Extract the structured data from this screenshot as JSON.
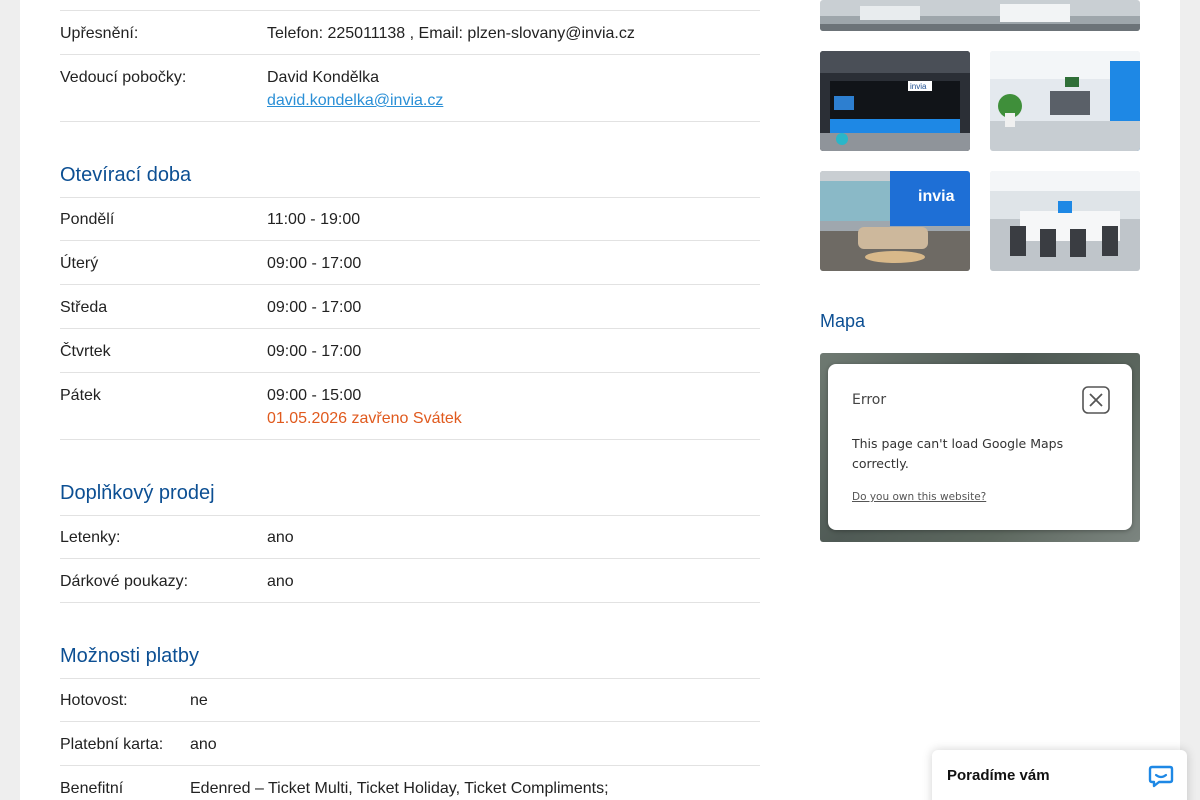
{
  "contact": {
    "refine_label": "Upřesnění:",
    "refine_value": "Telefon: 225011138 , Email: plzen-slovany@invia.cz",
    "manager_label": "Vedoucí pobočky:",
    "manager_name": "David Kondělka",
    "manager_email": "david.kondelka@invia.cz"
  },
  "opening_hours": {
    "title": "Otevírací doba",
    "days": [
      {
        "day": "Pondělí",
        "hours": "11:00 - 19:00"
      },
      {
        "day": "Úterý",
        "hours": "09:00 - 17:00"
      },
      {
        "day": "Středa",
        "hours": "09:00 - 17:00"
      },
      {
        "day": "Čtvrtek",
        "hours": "09:00 - 17:00"
      },
      {
        "day": "Pátek",
        "hours": "09:00 - 15:00",
        "note": "01.05.2026 zavřeno Svátek"
      }
    ]
  },
  "extra_sales": {
    "title": "Doplňkový prodej",
    "items": [
      {
        "label": "Letenky:",
        "value": "ano"
      },
      {
        "label": "Dárkové poukazy:",
        "value": "ano"
      }
    ]
  },
  "payment": {
    "title": "Možnosti platby",
    "items": [
      {
        "label": "Hotovost:",
        "value": "ne"
      },
      {
        "label": "Platební karta:",
        "value": "ano"
      },
      {
        "label": "Benefitní",
        "value": "Edenred – Ticket Multi, Ticket Holiday, Ticket Compliments;"
      }
    ]
  },
  "gallery": {
    "logo_text": "invia"
  },
  "map": {
    "title": "Mapa",
    "error_title": "Error",
    "error_message": "This page can't load Google Maps correctly.",
    "error_link": "Do you own this website?"
  },
  "chat": {
    "label": "Poradíme vám"
  },
  "colors": {
    "heading": "#0c4f93",
    "link": "#2a8fd6",
    "note": "#e05a1e",
    "brand_blue": "#1e88e5"
  }
}
